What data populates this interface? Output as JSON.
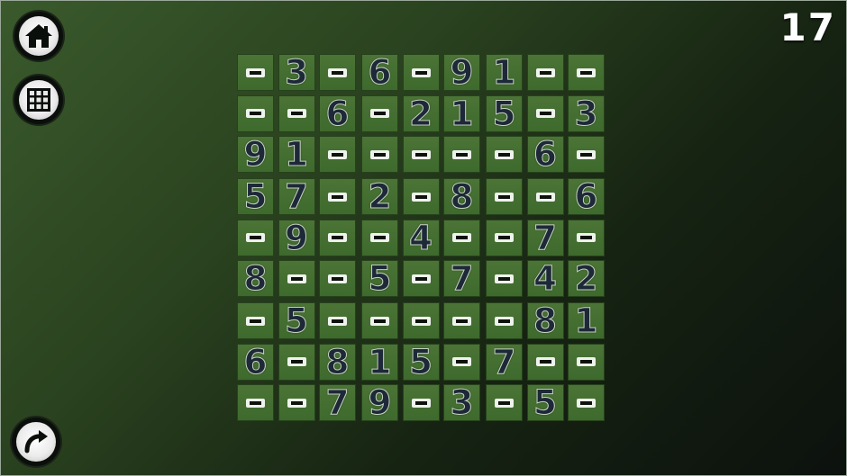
{
  "counter": "17",
  "buttons": {
    "home": "home-icon",
    "levels": "grid-icon",
    "undo": "undo-icon"
  },
  "colors": {
    "cell": "#426f30",
    "digit": "#1d2838",
    "counter": "#ffffff"
  },
  "board": [
    [
      "",
      "3",
      "",
      "6",
      "",
      "9",
      "1",
      "",
      ""
    ],
    [
      "",
      "",
      "6",
      "",
      "2",
      "1",
      "5",
      "",
      "3"
    ],
    [
      "9",
      "1",
      "",
      "",
      "",
      "",
      "",
      "6",
      ""
    ],
    [
      "5",
      "7",
      "",
      "2",
      "",
      "8",
      "",
      "",
      "6"
    ],
    [
      "",
      "9",
      "",
      "",
      "4",
      "",
      "",
      "7",
      ""
    ],
    [
      "8",
      "",
      "",
      "5",
      "",
      "7",
      "",
      "4",
      "2"
    ],
    [
      "",
      "5",
      "",
      "",
      "",
      "",
      "",
      "8",
      "1"
    ],
    [
      "6",
      "",
      "8",
      "1",
      "5",
      "",
      "7",
      "",
      ""
    ],
    [
      "",
      "",
      "7",
      "9",
      "",
      "3",
      "",
      "5",
      ""
    ]
  ]
}
